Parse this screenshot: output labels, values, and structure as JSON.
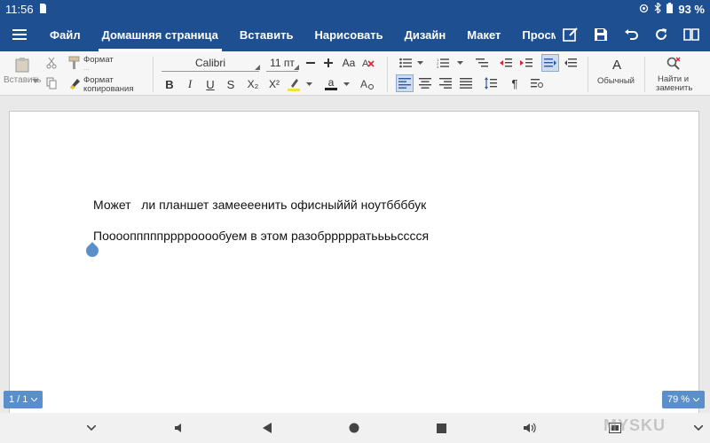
{
  "status": {
    "time": "11:56",
    "battery": "93 %"
  },
  "menu": {
    "tabs": [
      "Файл",
      "Домашняя страница",
      "Вставить",
      "Нарисовать",
      "Дизайн",
      "Макет",
      "Просмотр"
    ],
    "active_tab": "Домашняя страница"
  },
  "ribbon": {
    "paste_label": "Вставить",
    "format_label_1": "Формат",
    "format_label_1_sub": "...",
    "format_label_2": "Формат",
    "format_label_2_sub": "копирования",
    "font_name": "Calibri",
    "font_size": "11 пт",
    "bold": "B",
    "italic": "I",
    "underline": "U",
    "strike": "S",
    "subscript": "X₂",
    "superscript": "X²",
    "text_color_glyph": "a",
    "font_case": "Aa",
    "styles_glyph": "A",
    "style_label": "Обычный",
    "find_label_1": "Найти и",
    "find_label_2": "заменить",
    "pilcrow": "¶"
  },
  "document": {
    "paragraphs": [
      "Может   ли планшет замеееенить офисныййй ноутббббук",
      "Поооопппппррррооообуем в этом разобррррратььььсссся"
    ]
  },
  "page_indicator": "1 / 1",
  "zoom": "79 %",
  "watermark": "MYSKU",
  "colors": {
    "brand": "#1d4f91",
    "accent": "#5b8fc9",
    "highlight": "#f1e33a"
  }
}
